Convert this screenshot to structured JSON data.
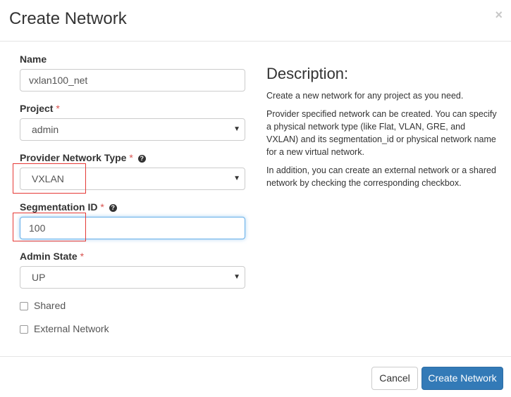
{
  "dialog": {
    "title": "Create Network",
    "close_glyph": "×"
  },
  "form": {
    "name": {
      "label": "Name",
      "value": "vxlan100_net"
    },
    "project": {
      "label": "Project",
      "required_mark": "*",
      "value": "admin"
    },
    "provider_type": {
      "label": "Provider Network Type",
      "required_mark": "*",
      "value": "VXLAN",
      "help_icon": "question-circle-icon"
    },
    "segmentation_id": {
      "label": "Segmentation ID",
      "required_mark": "*",
      "value": "100",
      "help_icon": "question-circle-icon"
    },
    "admin_state": {
      "label": "Admin State",
      "required_mark": "*",
      "value": "UP"
    },
    "shared": {
      "label": "Shared",
      "checked": false
    },
    "external": {
      "label": "External Network",
      "checked": false
    }
  },
  "description": {
    "title": "Description:",
    "paragraphs": [
      "Create a new network for any project as you need.",
      "Provider specified network can be created. You can specify a physical network type (like Flat, VLAN, GRE, and VXLAN) and its segmentation_id or physical network name for a new virtual network.",
      "In addition, you can create an external network or a shared network by checking the corresponding checkbox."
    ]
  },
  "footer": {
    "cancel_label": "Cancel",
    "submit_label": "Create Network"
  },
  "colors": {
    "primary": "#337ab7",
    "required": "#d9534f",
    "highlight": "#e53935",
    "focus": "#66afe9"
  }
}
